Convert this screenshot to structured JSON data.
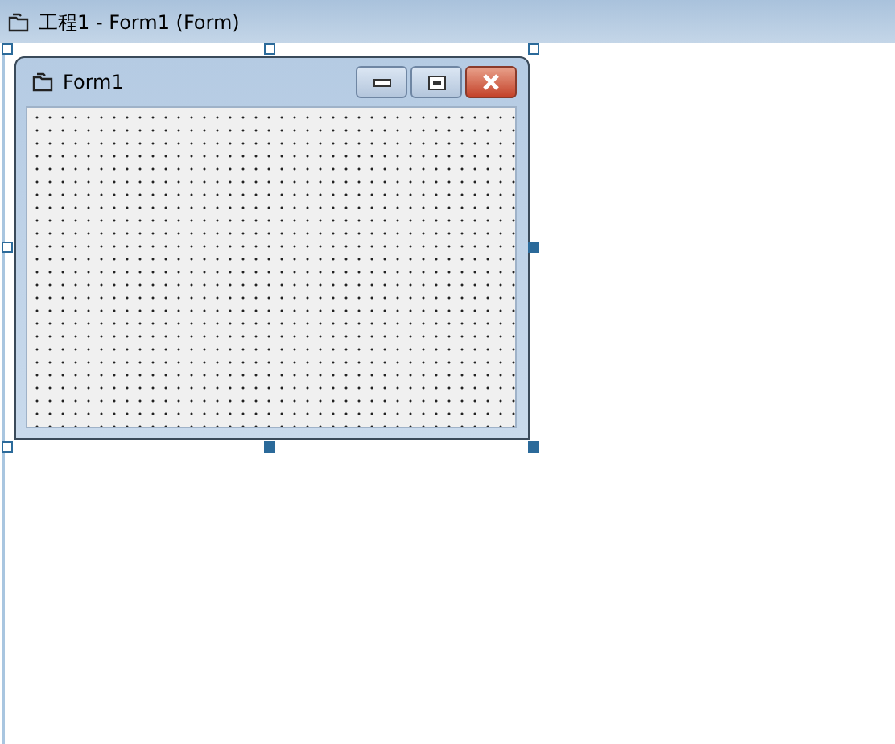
{
  "window": {
    "title": "工程1 - Form1 (Form)"
  },
  "form": {
    "title": "Form1",
    "grid": true,
    "caption_buttons": [
      {
        "kind": "minimize"
      },
      {
        "kind": "maximize"
      },
      {
        "kind": "close"
      }
    ]
  },
  "selection_handles": [
    {
      "filled": false
    },
    {
      "filled": false
    },
    {
      "filled": false
    },
    {
      "filled": false
    },
    {
      "filled": true
    },
    {
      "filled": false
    },
    {
      "filled": true
    },
    {
      "filled": true
    }
  ]
}
